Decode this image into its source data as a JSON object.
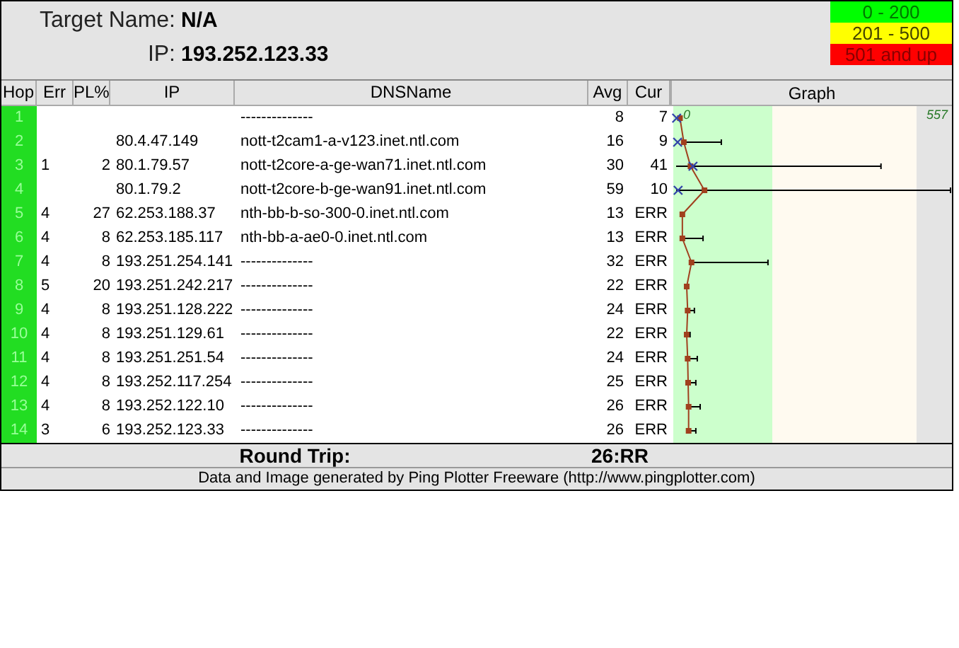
{
  "target": {
    "name_label": "Target Name:",
    "name_value": "N/A",
    "ip_label": "IP:",
    "ip_value": "193.252.123.33"
  },
  "legend": [
    {
      "label": "0 - 200",
      "color": "#00ff00"
    },
    {
      "label": "201 - 500",
      "color": "#ffff00"
    },
    {
      "label": "501 and up",
      "color": "#ff0000"
    }
  ],
  "table": {
    "columns": [
      "Hop",
      "Err",
      "PL%",
      "IP",
      "DNSName",
      "Avg",
      "Cur",
      "Graph"
    ],
    "rows": [
      {
        "hop": "1",
        "err": "",
        "pl": "",
        "ip": "",
        "dns": "--------------",
        "avg": "8",
        "cur": "7"
      },
      {
        "hop": "2",
        "err": "",
        "pl": "",
        "ip": "80.4.47.149",
        "dns": "nott-t2cam1-a-v123.inet.ntl.com",
        "avg": "16",
        "cur": "9"
      },
      {
        "hop": "3",
        "err": "1",
        "pl": "2",
        "ip": "80.1.79.57",
        "dns": "nott-t2core-a-ge-wan71.inet.ntl.com",
        "avg": "30",
        "cur": "41"
      },
      {
        "hop": "4",
        "err": "",
        "pl": "",
        "ip": "80.1.79.2",
        "dns": "nott-t2core-b-ge-wan91.inet.ntl.com",
        "avg": "59",
        "cur": "10"
      },
      {
        "hop": "5",
        "err": "4",
        "pl": "27",
        "ip": "62.253.188.37",
        "dns": "nth-bb-b-so-300-0.inet.ntl.com",
        "avg": "13",
        "cur": "ERR"
      },
      {
        "hop": "6",
        "err": "4",
        "pl": "8",
        "ip": "62.253.185.117",
        "dns": "nth-bb-a-ae0-0.inet.ntl.com",
        "avg": "13",
        "cur": "ERR"
      },
      {
        "hop": "7",
        "err": "4",
        "pl": "8",
        "ip": "193.251.254.141",
        "dns": "--------------",
        "avg": "32",
        "cur": "ERR"
      },
      {
        "hop": "8",
        "err": "5",
        "pl": "20",
        "ip": "193.251.242.217",
        "dns": "--------------",
        "avg": "22",
        "cur": "ERR"
      },
      {
        "hop": "9",
        "err": "4",
        "pl": "8",
        "ip": "193.251.128.222",
        "dns": "--------------",
        "avg": "24",
        "cur": "ERR"
      },
      {
        "hop": "10",
        "err": "4",
        "pl": "8",
        "ip": "193.251.129.61",
        "dns": "--------------",
        "avg": "22",
        "cur": "ERR"
      },
      {
        "hop": "11",
        "err": "4",
        "pl": "8",
        "ip": "193.251.251.54",
        "dns": "--------------",
        "avg": "24",
        "cur": "ERR"
      },
      {
        "hop": "12",
        "err": "4",
        "pl": "8",
        "ip": "193.252.117.254",
        "dns": "--------------",
        "avg": "25",
        "cur": "ERR"
      },
      {
        "hop": "13",
        "err": "4",
        "pl": "8",
        "ip": "193.252.122.10",
        "dns": "--------------",
        "avg": "26",
        "cur": "ERR"
      },
      {
        "hop": "14",
        "err": "3",
        "pl": "6",
        "ip": "193.252.123.33",
        "dns": "--------------",
        "avg": "26",
        "cur": "ERR"
      }
    ],
    "graph": {
      "scale_start": "0",
      "scale_end": "557"
    }
  },
  "round_trip": {
    "label": "Round Trip:",
    "value": "26:RR"
  },
  "footer": "Data and Image generated by Ping Plotter Freeware (http://www.pingplotter.com)"
}
